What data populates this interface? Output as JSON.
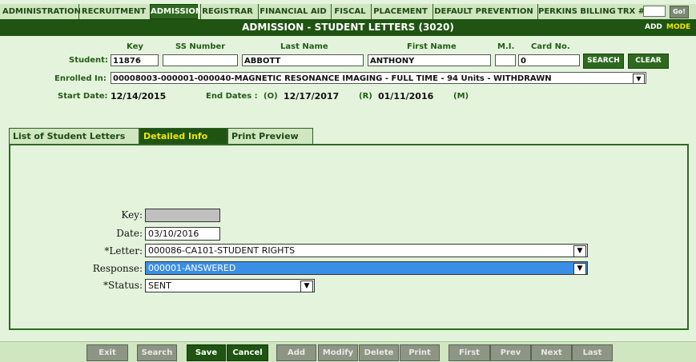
{
  "nav": {
    "tabs": [
      "ADMINISTRATION",
      "RECRUITMENT",
      "ADMISSION",
      "REGISTRAR",
      "FINANCIAL AID",
      "FISCAL",
      "PLACEMENT",
      "DEFAULT PREVENTION",
      "PERKINS BILLING"
    ],
    "trx_label": "TRX #:",
    "go_label": "Go!"
  },
  "title": {
    "text": "ADMISSION - STUDENT LETTERS (3020)",
    "add": "ADD",
    "mode": "MODE"
  },
  "student": {
    "headers": {
      "key": "Key",
      "ss": "SS Number",
      "last": "Last Name",
      "first": "First Name",
      "mi": "M.I.",
      "card": "Card No."
    },
    "label": "Student:",
    "key": "11876",
    "ss": "",
    "last": "ABBOTT",
    "first": "ANTHONY",
    "mi": "",
    "card": "0",
    "search": "SEARCH",
    "clear": "CLEAR",
    "enrolled_label": "Enrolled In:",
    "enrolled_value": "00008003-000001-000040-MAGNETIC RESONANCE IMAGING - FULL TIME - 94 Units - WITHDRAWN",
    "start_label": "Start Date:",
    "start_value": "12/14/2015",
    "end_label": "End Dates :",
    "o_label": "(O)",
    "o_value": "12/17/2017",
    "r_label": "(R)",
    "r_value": "01/11/2016",
    "m_label": "(M)"
  },
  "tabs": [
    "List of Student Letters",
    "Detailed Info",
    "Print Preview"
  ],
  "form": {
    "key_label": "Key:",
    "key_value": "",
    "date_label": "Date:",
    "date_value": "03/10/2016",
    "letter_label": "*Letter:",
    "letter_value": "000086-CA101-STUDENT RIGHTS",
    "response_label": "Response:",
    "response_value": "000001-ANSWERED",
    "status_label": "*Status:",
    "status_value": "SENT"
  },
  "buttons": [
    "Exit",
    "Search",
    "Save",
    "Cancel",
    "Add",
    "Modify",
    "Delete",
    "Print",
    "First",
    "Prev",
    "Next",
    "Last"
  ],
  "colors": {
    "accent": "#1f5412",
    "background": "#e4f4dc",
    "highlight": "#3a8ee6"
  }
}
